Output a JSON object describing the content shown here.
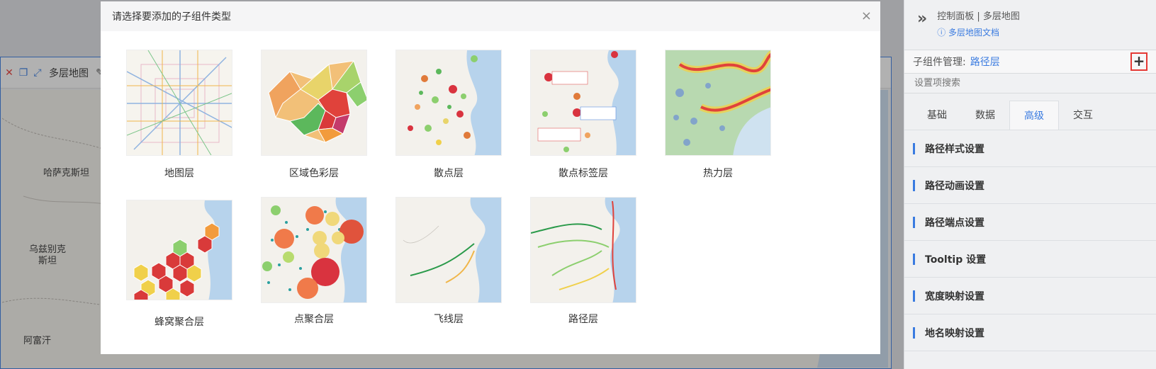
{
  "modal": {
    "title": "请选择要添加的子组件类型",
    "close_symbol": "×",
    "layer_types": [
      {
        "label": "地图层",
        "icon": "map-layer-thumb"
      },
      {
        "label": "区域色彩层",
        "icon": "region-color-thumb"
      },
      {
        "label": "散点层",
        "icon": "scatter-thumb"
      },
      {
        "label": "散点标签层",
        "icon": "scatter-label-thumb"
      },
      {
        "label": "热力层",
        "icon": "heat-thumb"
      },
      {
        "label": "蜂窝聚合层",
        "icon": "hexbin-thumb"
      },
      {
        "label": "点聚合层",
        "icon": "cluster-thumb"
      },
      {
        "label": "飞线层",
        "icon": "flyline-thumb"
      },
      {
        "label": "路径层",
        "icon": "path-thumb"
      }
    ]
  },
  "widget": {
    "title": "多层地图",
    "map_labels": [
      "哈萨克斯坦",
      "乌兹别克斯坦",
      "阿富汗"
    ]
  },
  "panel": {
    "title": "控制面板 | 多层地图",
    "doc_link": "多层地图文档",
    "sub_manage_label": "子组件管理:",
    "sub_manage_value": "路径层",
    "add_symbol": "+",
    "search_placeholder": "设置项搜索",
    "tabs": [
      "基础",
      "数据",
      "高级",
      "交互"
    ],
    "active_tab": "高级",
    "sections": [
      "路径样式设置",
      "路径动画设置",
      "路径端点设置",
      "Tooltip 设置",
      "宽度映射设置",
      "地名映射设置"
    ]
  },
  "colors": {
    "accent": "#3a7be0",
    "close_red": "#e53935"
  }
}
